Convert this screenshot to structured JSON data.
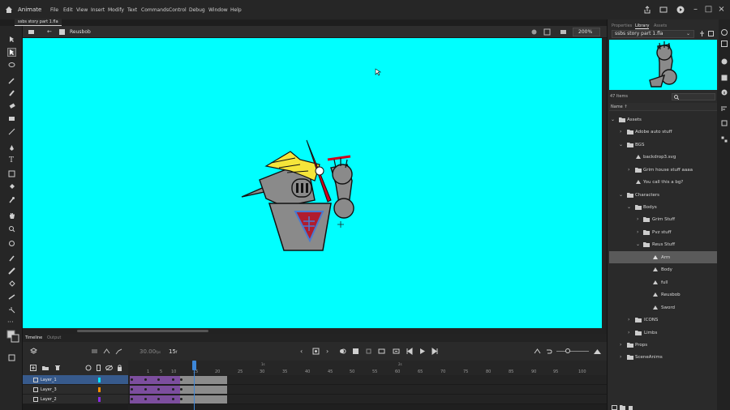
{
  "app": {
    "name": "Animate"
  },
  "menu": [
    "File",
    "Edit",
    "View",
    "Insert",
    "Modify",
    "Text",
    "Commands",
    "Control",
    "Debug",
    "Window",
    "Help"
  ],
  "document": {
    "tab": "ssbs story part 1.fla"
  },
  "editbar": {
    "scene": "Reusbob",
    "zoom": "200%"
  },
  "timeline": {
    "tabs": [
      "Timeline",
      "Output"
    ],
    "fps": "30.00",
    "fps_unit": "fps",
    "frame": "15",
    "frame_unit": "f",
    "ruler": [
      "1",
      "5",
      "10",
      "15",
      "20",
      "25",
      "30",
      "35",
      "40",
      "45",
      "50",
      "55",
      "60",
      "65",
      "70",
      "75",
      "80",
      "85",
      "90",
      "95",
      "100"
    ],
    "ruler_secs": [
      "1s",
      "2s"
    ],
    "layers": [
      {
        "name": "Layer_1",
        "color": "#00e5ff",
        "selected": true
      },
      {
        "name": "Layer_3",
        "color": "#ff8c00",
        "selected": false
      },
      {
        "name": "Layer_2",
        "color": "#8a2be2",
        "selected": false
      }
    ]
  },
  "right_panel": {
    "tabs": [
      "Properties",
      "Library",
      "Assets"
    ],
    "library_select": "ssbs story part 1.fla",
    "item_count": "47 Items",
    "name_col": "Name",
    "items": [
      {
        "label": "Assets",
        "depth": 0,
        "type": "folder",
        "open": true
      },
      {
        "label": "Adobe auto stuff",
        "depth": 1,
        "type": "folder",
        "open": false
      },
      {
        "label": "BGS",
        "depth": 1,
        "type": "folder",
        "open": true
      },
      {
        "label": "backdrop3.svg",
        "depth": 2,
        "type": "graphic"
      },
      {
        "label": "Grim house stuff aaaa",
        "depth": 2,
        "type": "folder",
        "open": false
      },
      {
        "label": "You call this a bg?",
        "depth": 2,
        "type": "graphic"
      },
      {
        "label": "Characters",
        "depth": 1,
        "type": "folder",
        "open": true
      },
      {
        "label": "Bodys",
        "depth": 2,
        "type": "folder",
        "open": true
      },
      {
        "label": "Grim Stuff",
        "depth": 3,
        "type": "folder",
        "open": false
      },
      {
        "label": "Pvz stuff",
        "depth": 3,
        "type": "folder",
        "open": false
      },
      {
        "label": "Reus Stuff",
        "depth": 3,
        "type": "folder",
        "open": true
      },
      {
        "label": "Arm",
        "depth": 4,
        "type": "graphic",
        "selected": true
      },
      {
        "label": "Body",
        "depth": 4,
        "type": "graphic"
      },
      {
        "label": "full",
        "depth": 4,
        "type": "graphic"
      },
      {
        "label": "Reusbob",
        "depth": 4,
        "type": "graphic"
      },
      {
        "label": "Sword",
        "depth": 4,
        "type": "graphic"
      },
      {
        "label": "ICONS",
        "depth": 2,
        "type": "folder",
        "open": false
      },
      {
        "label": "Limbs",
        "depth": 2,
        "type": "folder",
        "open": false
      },
      {
        "label": "Props",
        "depth": 1,
        "type": "folder",
        "open": false
      },
      {
        "label": "SceneAnims",
        "depth": 1,
        "type": "folder",
        "open": false
      }
    ]
  },
  "colors": {
    "stage": "#00ffff",
    "accent": "#3d87d9",
    "purple_span": "#7c4e9e"
  }
}
